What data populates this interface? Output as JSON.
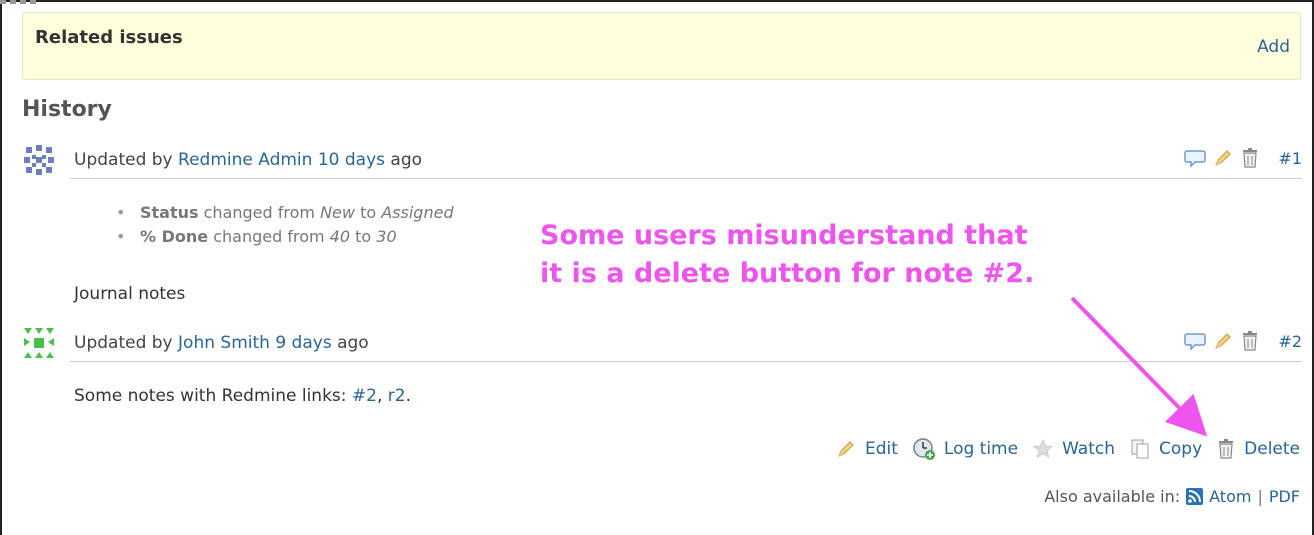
{
  "related": {
    "title": "Related issues",
    "add_label": "Add"
  },
  "history": {
    "title": "History"
  },
  "journals": [
    {
      "updated_by_prefix": "Updated by",
      "author": "Redmine Admin",
      "time": "10 days",
      "time_suffix": "ago",
      "number": "#1",
      "avatar_color": "#6a7fbf",
      "details": [
        {
          "field": "Status",
          "changed_from": "changed from",
          "old": "New",
          "to": "to",
          "new": "Assigned"
        },
        {
          "field": "% Done",
          "changed_from": "changed from",
          "old": "40",
          "to": "to",
          "new": "30"
        }
      ],
      "notes": "Journal notes"
    },
    {
      "updated_by_prefix": "Updated by",
      "author": "John Smith",
      "time": "9 days",
      "time_suffix": "ago",
      "number": "#2",
      "avatar_color": "#4bbf4b",
      "notes_prefix": "Some notes with Redmine links:",
      "links": [
        "#2",
        "r2"
      ],
      "link_sep": ",",
      "notes_end": "."
    }
  ],
  "actions": {
    "edit": "Edit",
    "log_time": "Log time",
    "watch": "Watch",
    "copy": "Copy",
    "delete": "Delete"
  },
  "formats": {
    "label": "Also available in:",
    "atom": "Atom",
    "sep": "|",
    "pdf": "PDF"
  },
  "annotation": {
    "line1": "Some users misunderstand that",
    "line2": "it is a delete button for note #2.",
    "color": "#ee55ee"
  },
  "colors": {
    "link": "#2a6496",
    "related_bg": "#ffffdd"
  },
  "icons": [
    "quote-icon",
    "pencil-icon",
    "trash-icon",
    "clock-icon",
    "star-icon",
    "copy-icon",
    "feed-icon"
  ]
}
